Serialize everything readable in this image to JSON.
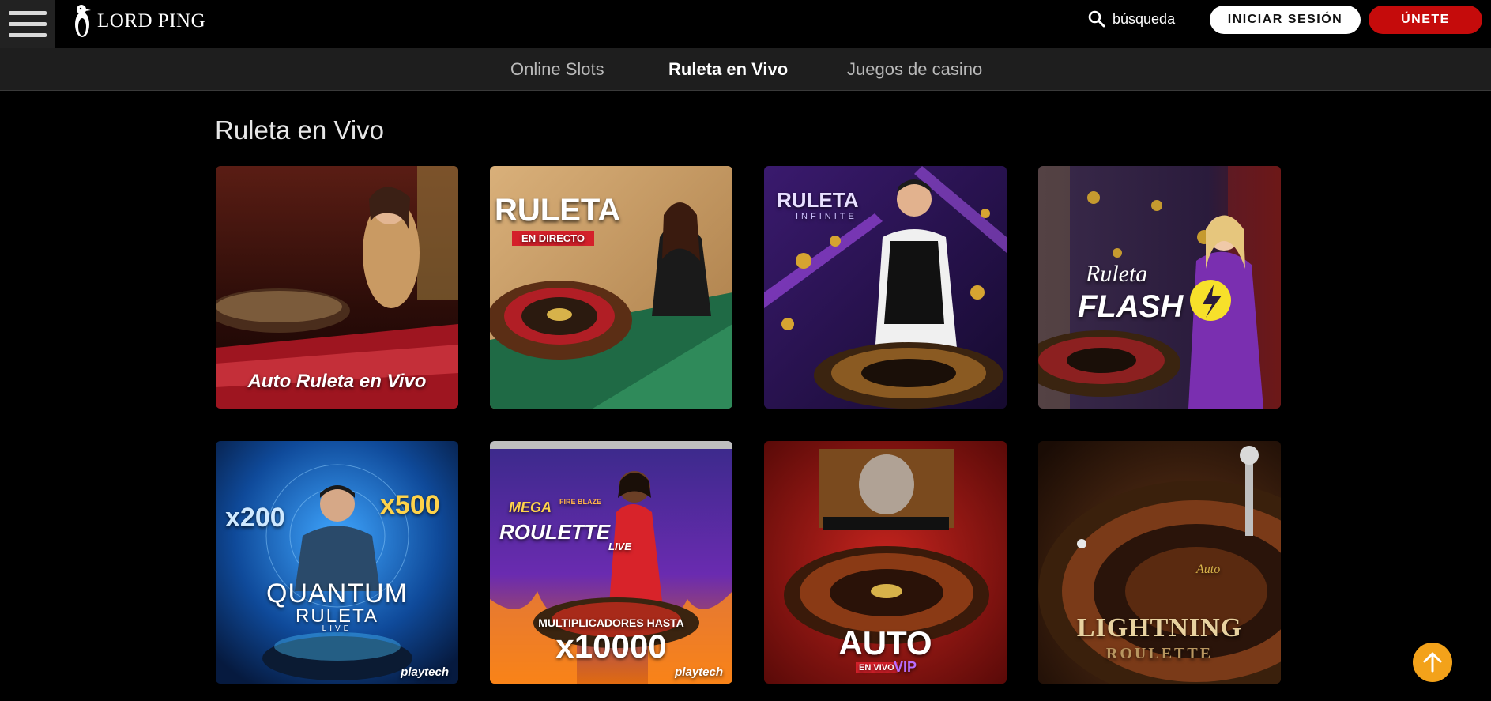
{
  "header": {
    "logo_text": "LORD PING",
    "search_label": "búsqueda",
    "login_label": "INICIAR SESIÓN",
    "join_label": "ÚNETE"
  },
  "subnav": {
    "items": [
      {
        "label": "Online Slots",
        "active": false
      },
      {
        "label": "Ruleta en Vivo",
        "active": true
      },
      {
        "label": "Juegos de casino",
        "active": false
      }
    ]
  },
  "page": {
    "title": "Ruleta en Vivo"
  },
  "games": [
    {
      "name": "Auto Ruleta en Vivo",
      "lines": [
        "Auto Ruleta en Vivo"
      ]
    },
    {
      "name": "Ruleta en Directo",
      "lines": [
        "RULETA",
        "EN DIRECTO"
      ]
    },
    {
      "name": "Ruleta Infinite",
      "lines": [
        "RULETA",
        "INFINITE"
      ]
    },
    {
      "name": "Ruleta Flash",
      "lines": [
        "Ruleta",
        "FLASH"
      ]
    },
    {
      "name": "Quantum Ruleta Live",
      "lines": [
        "x200",
        "x500",
        "QUANTUM",
        "RULETA",
        "LIVE",
        "playtech"
      ]
    },
    {
      "name": "Mega Fire Blaze Roulette Live",
      "lines": [
        "MEGA",
        "FIRE BLAZE",
        "ROULETTE",
        "LIVE",
        "MULTIPLICADORES HASTA",
        "x10000",
        "playtech"
      ]
    },
    {
      "name": "Auto Roulette En Vivo VIP",
      "lines": [
        "AUTO",
        "EN VIVO",
        "VIP"
      ]
    },
    {
      "name": "Lightning Roulette",
      "lines": [
        "Auto",
        "LIGHTNING",
        "ROULETTE"
      ]
    }
  ],
  "colors": {
    "accent_red": "#c50b0b",
    "scroll_top": "#f3a21a"
  },
  "icons": {
    "menu": "hamburger-icon",
    "search": "search-icon",
    "scroll_top": "arrow-up-icon"
  }
}
